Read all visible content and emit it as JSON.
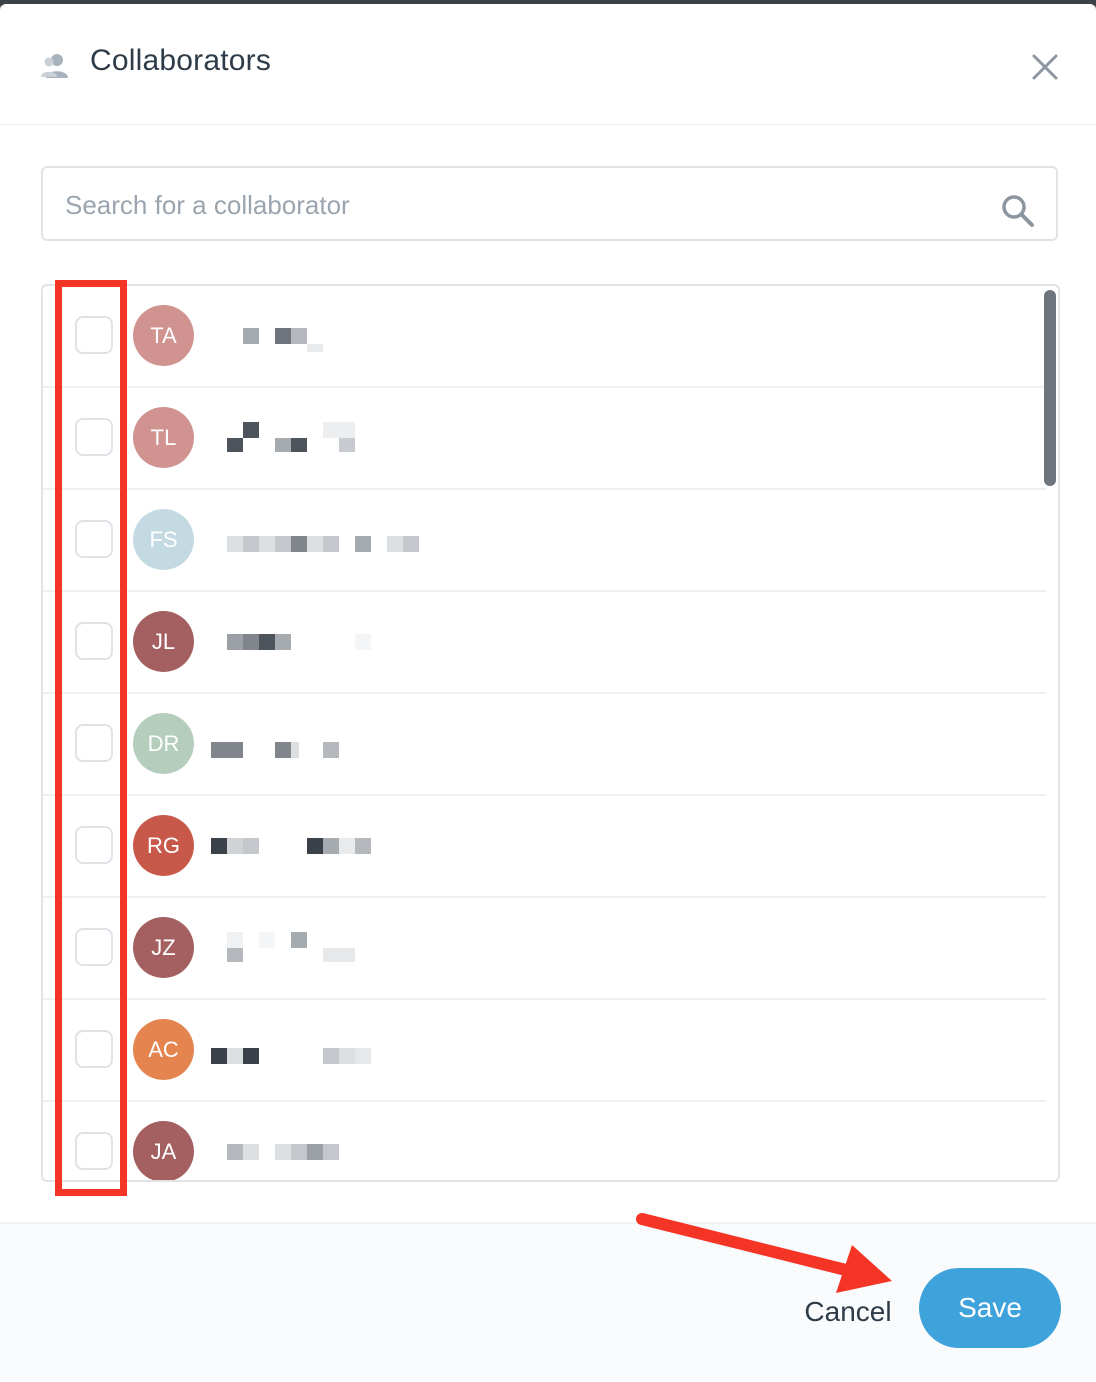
{
  "dialog": {
    "title": "Collaborators",
    "icon": "users-icon",
    "close_icon": "close-icon"
  },
  "search": {
    "placeholder": "Search for a collaborator",
    "value": "",
    "icon": "search-icon"
  },
  "collaborators": [
    {
      "initials": "TA",
      "color": "#d09390",
      "checked": false
    },
    {
      "initials": "TL",
      "color": "#d09390",
      "checked": false
    },
    {
      "initials": "FS",
      "color": "#c4dae3",
      "checked": false
    },
    {
      "initials": "JL",
      "color": "#a45f60",
      "checked": false
    },
    {
      "initials": "DR",
      "color": "#b4cdbd",
      "checked": false
    },
    {
      "initials": "RG",
      "color": "#c8594a",
      "checked": false
    },
    {
      "initials": "JZ",
      "color": "#a45f60",
      "checked": false
    },
    {
      "initials": "AC",
      "color": "#e4844f",
      "checked": false
    },
    {
      "initials": "JA",
      "color": "#a45f60",
      "checked": false
    }
  ],
  "footer": {
    "cancel_label": "Cancel",
    "save_label": "Save"
  },
  "colors": {
    "accent": "#3ea2db",
    "annotation": "#f43526",
    "title_text": "#2e3b48"
  }
}
